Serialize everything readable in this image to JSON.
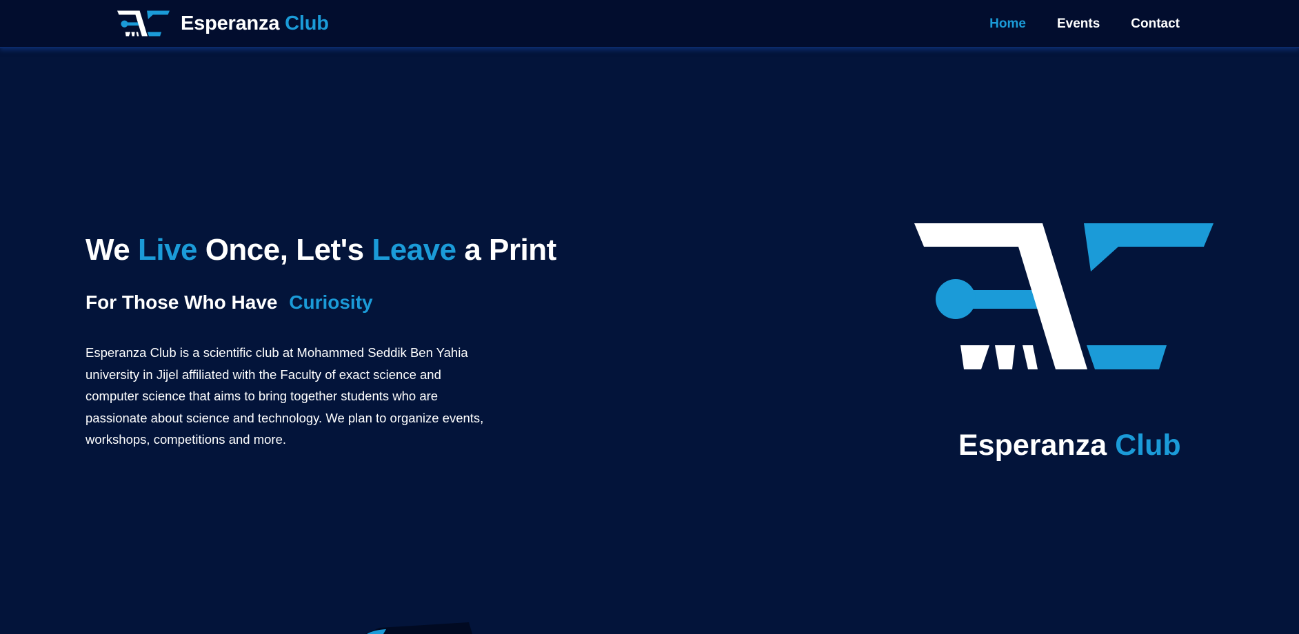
{
  "nav": {
    "brand": {
      "name": "Esperanza",
      "accent": "Club"
    },
    "links": [
      "Home",
      "Events",
      "Contact"
    ],
    "active_link": "Home"
  },
  "hero": {
    "title": {
      "part1": "We ",
      "accent1": "Live",
      "part2": " Once, Let's ",
      "accent2": "Leave",
      "part3": " a Print"
    },
    "subtitle": {
      "text": "For Those Who Have",
      "accent": "Curiosity"
    },
    "description": "Esperanza Club is a scientific club at Mohammed Seddik Ben Yahia university in Jijel affiliated with the Faculty of exact science and computer science that aims to bring together students who are passionate about science and technology. We plan to organize events, workshops, competitions and more."
  },
  "showcase": {
    "brand_name": "Esperanza",
    "brand_accent": "Club"
  },
  "colors": {
    "background": "#03143a",
    "navbar": "#020d2e",
    "accent": "#1b9bd8",
    "text": "#ffffff"
  }
}
